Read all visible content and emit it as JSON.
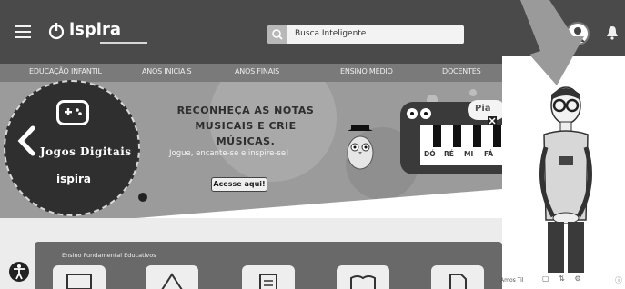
{
  "header": {
    "logo_text": "ispira",
    "search_placeholder": "Busca Inteligente",
    "colors": {
      "header_bg": "#4a4a4a",
      "nav_bg": "#7a7a7a"
    }
  },
  "nav": {
    "items": [
      "EDUCAÇÃO INFANTIL",
      "ANOS INICIAIS",
      "ANOS FINAIS",
      "ENSINO MÉDIO",
      "DOCENTES"
    ]
  },
  "banner": {
    "badge_title": "Jogos Digitais",
    "badge_logo": "ispira",
    "headline_line1": "RECONHEÇA AS NOTAS",
    "headline_line2": "MUSICAIS E CRIE MÚSICAS.",
    "subline": "Jogue, encante-se e inspire-se!",
    "cta_label": "Acesse aqui!",
    "piano_title": "Pia",
    "keys": [
      "DÓ",
      "RÉ",
      "MI",
      "FÁ"
    ]
  },
  "section": {
    "title": "Ensino Fundamental Educativos"
  },
  "character_pane": {
    "footer_label": "Amos Til"
  },
  "icons": [
    "menu-icon",
    "search-icon",
    "bell-icon",
    "game-controller-icon",
    "chevron-left-icon",
    "accessibility-icon",
    "close-icon",
    "arrow-icon"
  ]
}
